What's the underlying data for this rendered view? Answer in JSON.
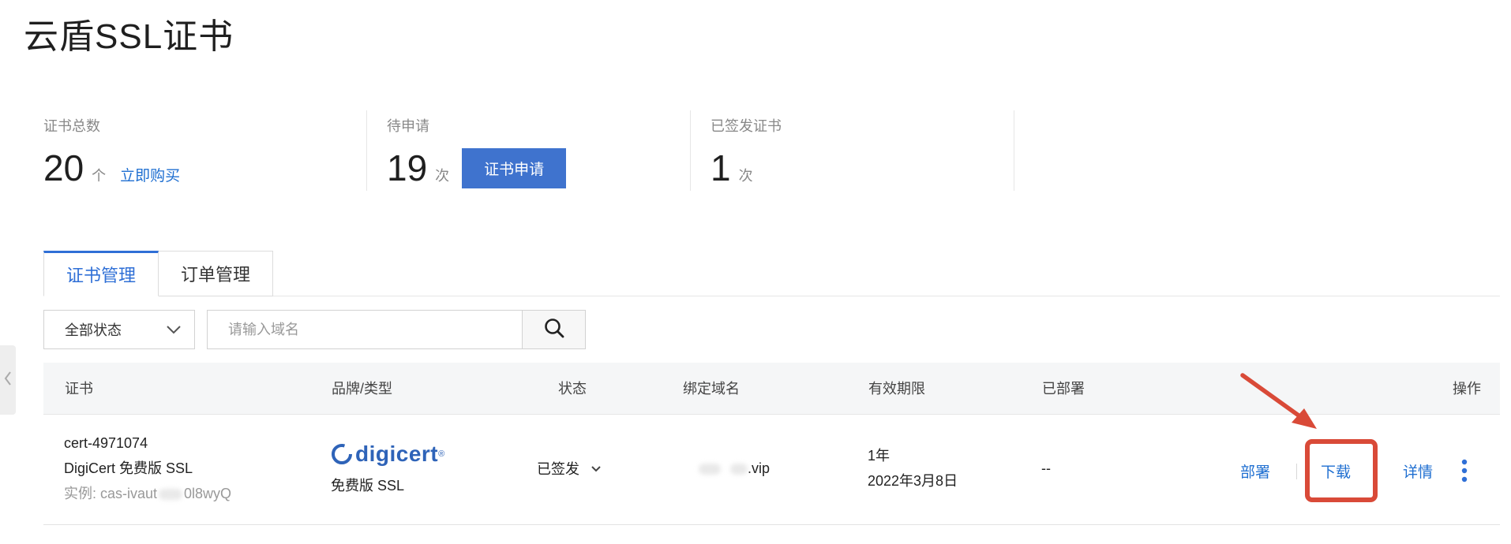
{
  "page_title": "云盾SSL证书",
  "stats": [
    {
      "label": "证书总数",
      "value": "20",
      "unit": "个",
      "link": "立即购买"
    },
    {
      "label": "待申请",
      "value": "19",
      "unit": "次",
      "button": "证书申请"
    },
    {
      "label": "已签发证书",
      "value": "1",
      "unit": "次"
    }
  ],
  "tabs": [
    {
      "label": "证书管理",
      "active": true
    },
    {
      "label": "订单管理",
      "active": false
    }
  ],
  "filter": {
    "status_selected": "全部状态",
    "search_placeholder": "请输入域名"
  },
  "table": {
    "headers": {
      "cert": "证书",
      "brand": "品牌/类型",
      "status": "状态",
      "domain": "绑定域名",
      "validity": "有效期限",
      "deployed": "已部署",
      "actions": "操作"
    },
    "rows": [
      {
        "cert_id": "cert-4971074",
        "cert_name": "DigiCert 免费版 SSL",
        "instance": "实例: cas-ivaut",
        "instance_tail": "0l8wyQ",
        "brand": "digicert",
        "brand_type": "免费版 SSL",
        "status": "已签发",
        "domain_suffix": ".vip",
        "validity_period": "1年",
        "validity_date": "2022年3月8日",
        "deployed": "--",
        "actions": {
          "deploy": "部署",
          "download": "下载",
          "details": "详情"
        }
      }
    ]
  },
  "colors": {
    "accent": "#3f73ce",
    "link": "#1f6fd1",
    "highlight": "#d94a38",
    "brand": "#2e63b8"
  },
  "icons": {
    "search": "search-icon",
    "dropdown": "chevron-down-icon",
    "more": "more-vertical-icon",
    "collapse": "chevron-left-icon",
    "annotation": "arrow-annotation"
  }
}
